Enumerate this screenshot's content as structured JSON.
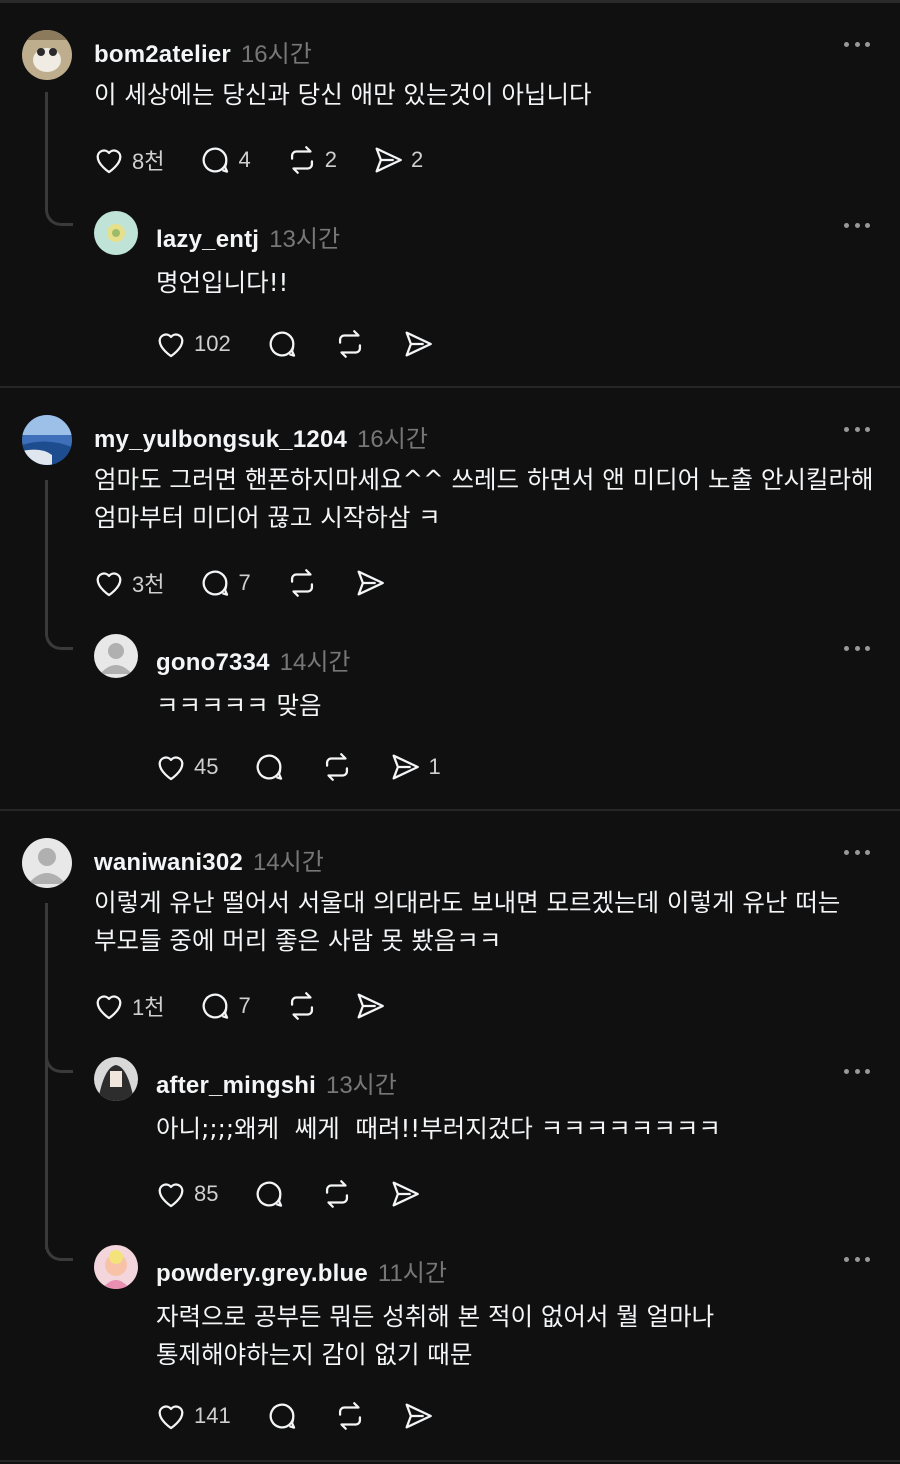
{
  "posts": [
    {
      "username": "bom2atelier",
      "time": "16시간",
      "text": [
        "이 세상에는 당신과 당신 애만 있는것이 아닙니다"
      ],
      "likes": "8천",
      "replies": "4",
      "reposts": "2",
      "shares": "2",
      "reply": {
        "username": "lazy_entj",
        "time": "13시간",
        "text": [
          "명언입니다!!"
        ],
        "likes": "102",
        "replies": "",
        "reposts": "",
        "shares": ""
      }
    },
    {
      "username": "my_yulbongsuk_1204",
      "time": "16시간",
      "text": [
        "엄마도 그러면 핸폰하지마세요^^ 쓰레드 하면서 앤 미디어 노출 안시킬라해",
        "엄마부터 미디어 끊고 시작하삼 ㅋ"
      ],
      "likes": "3천",
      "replies": "7",
      "reposts": "",
      "shares": "",
      "reply": {
        "username": "gono7334",
        "time": "14시간",
        "text": [
          "ㅋㅋㅋㅋㅋ 맞음"
        ],
        "likes": "45",
        "replies": "",
        "reposts": "",
        "shares": "1"
      }
    },
    {
      "username": "waniwani302",
      "time": "14시간",
      "text": [
        "이렇게 유난 떨어서 서울대 의대라도 보내면 모르겠는데 이렇게 유난 떠는",
        "부모들 중에 머리 좋은 사람 못 봤음ㅋㅋ"
      ],
      "likes": "1천",
      "replies": "7",
      "reposts": "",
      "shares": "",
      "replies_list": [
        {
          "username": "after_mingshi",
          "time": "13시간",
          "text": [
            "아니;;;;왜케  쎄게  때려!!부러지겄다 ㅋㅋㅋㅋㅋㅋㅋㅋ"
          ],
          "likes": "85",
          "replies": "",
          "reposts": "",
          "shares": ""
        },
        {
          "username": "powdery.grey.blue",
          "time": "11시간",
          "text": [
            "자력으로 공부든 뭐든 성취해 본 적이 없어서 뭘 얼마나",
            "통제해야하는지 감이 없기 때문"
          ],
          "likes": "141",
          "replies": "",
          "reposts": "",
          "shares": ""
        }
      ]
    }
  ],
  "icons": {
    "like": "heart-icon",
    "reply": "comment-icon",
    "repost": "repost-icon",
    "share": "send-icon",
    "more": "more-options-icon"
  },
  "colors": {
    "background": "#101010",
    "text": "#f3f5f7",
    "muted": "#777777"
  }
}
